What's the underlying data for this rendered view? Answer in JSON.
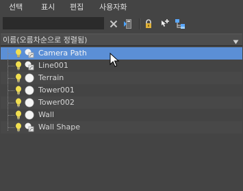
{
  "menu": [
    {
      "id": "select",
      "label": "선택"
    },
    {
      "id": "display",
      "label": "표시"
    },
    {
      "id": "edit",
      "label": "편집"
    },
    {
      "id": "customize",
      "label": "사용자화"
    }
  ],
  "toolbar": {
    "search_value": "",
    "icons": [
      "close-icon",
      "filter-icon",
      "lock-icon",
      "add-to-selection-icon",
      "hierarchy-icon"
    ]
  },
  "header": {
    "column_label": "이름(오름차순으로 정렬됨)"
  },
  "scene_explorer": {
    "items": [
      {
        "name": "Camera Path",
        "type": "shape",
        "selected": true
      },
      {
        "name": "Line001",
        "type": "shape",
        "selected": false
      },
      {
        "name": "Terrain",
        "type": "geometry",
        "selected": false
      },
      {
        "name": "Tower001",
        "type": "geometry",
        "selected": false
      },
      {
        "name": "Tower002",
        "type": "geometry",
        "selected": false
      },
      {
        "name": "Wall",
        "type": "geometry",
        "selected": false
      },
      {
        "name": "Wall Shape",
        "type": "shape",
        "selected": false
      }
    ]
  },
  "colors": {
    "background": "#444444",
    "selection": "#5b8fd6",
    "bulb": "#e8d64a"
  }
}
